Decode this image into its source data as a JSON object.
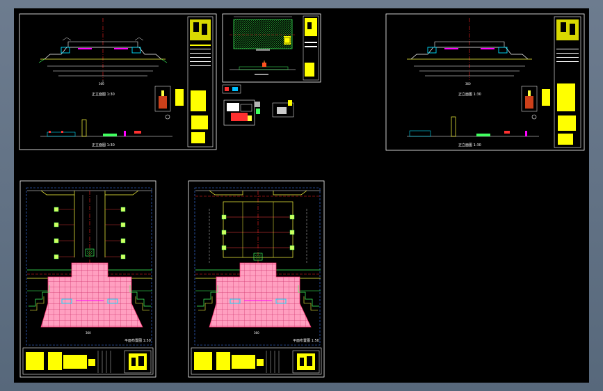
{
  "viewer": {
    "background": "#000000",
    "frame_color": "#5f7084"
  },
  "colors": {
    "sheet_border": "#ffffff",
    "title_block": "#ffff00",
    "center_line": "#ff2020",
    "grid_pink": "#ff6fa0",
    "wall_cyan": "#00e0ff",
    "green_line": "#40ff60",
    "yellow_line": "#ffff40",
    "magenta": "#ff00ff",
    "blue_dash": "#4080ff"
  },
  "sheets": [
    {
      "id": "elevation-sheet-1",
      "scale_label": "1:30",
      "title_label": "正立面图 1:30"
    },
    {
      "id": "detail-sheet",
      "scale_label": "1:20"
    },
    {
      "id": "elevation-sheet-2",
      "scale_label": "1:30",
      "title_label": "正立面图 1:30"
    },
    {
      "id": "plan-sheet-1",
      "scale_label": "1:50",
      "title_label": "平面布置图 1:50"
    },
    {
      "id": "plan-sheet-2",
      "scale_label": "1:50",
      "title_label": "平面布置图 1:50"
    }
  ],
  "dimension_label": "360"
}
